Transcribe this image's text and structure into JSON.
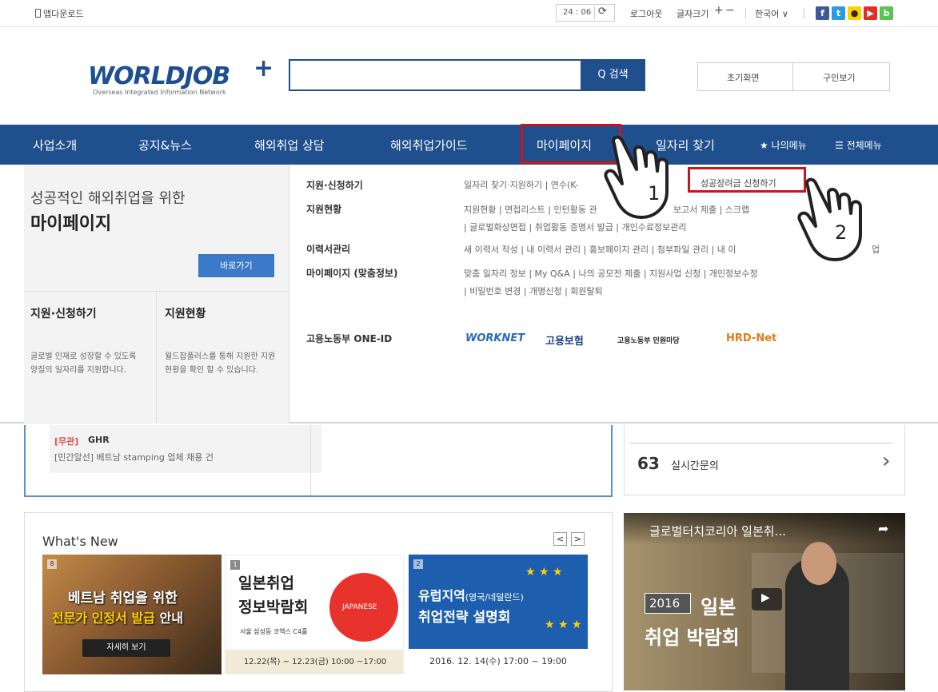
{
  "topbar": {
    "app_download": "앱다운로드",
    "timer": "24 : 06",
    "logout": "로그아웃",
    "font_size": "글자크기",
    "plus": "+",
    "minus": "−",
    "language": "한국어 ∨"
  },
  "header": {
    "logo_text": "WORLDJOB",
    "logo_plus": "+",
    "logo_sub": "Overseas Integrated Information Network",
    "search_placeholder": "",
    "search_label": "Q 검색",
    "home_label": "초기화면",
    "recruit_label": "구인보기"
  },
  "nav": {
    "items": [
      "사업소개",
      "공지&뉴스",
      "해외취업 상담",
      "해외취업가이드",
      "마이페이지",
      "일자리 찾기"
    ],
    "my_menu": "★ 나의메뉴",
    "all_menu": "☰ 전체메뉴"
  },
  "dropdown": {
    "tagline": "성공적인 해외취업을 위한",
    "title": "마이페이지",
    "go_button": "바로가기",
    "col1_title": "지원·신청하기",
    "col1_desc": "글로벌 인재로 성장할 수 있도록 양질의 일자리를 지원합니다.",
    "col2_title": "지원현황",
    "col2_desc": "월드잡플러스를 통해 지원한 지원현황을 확인 할 수 있습니다.",
    "sections": [
      {
        "title": "지원·신청하기",
        "lines": [
          "일자리 찾기·지원하기  |  연수(K-"
        ]
      },
      {
        "title": "지원현황",
        "lines": [
          "지원현황  |  면접리스트  |  인턴활동 관",
          "  |  글로벌화상면접  |  취업활동 증명서 발급  |  개인수료정보관리"
        ]
      },
      {
        "title": "이력서관리",
        "lines": [
          "새 이력서 작성  |  내 이력서 관리  |  홍보페이지 관리  |  첨부파일 관리  |  내 이"
        ]
      },
      {
        "title": "마이페이지 (맞춤정보)",
        "lines": [
          "맞춤 일자리 정보  |  My Q&A  |  나의 공모전 제출  |  지원사업 신청  |  개인정보수정",
          "  |  비밀번호 변경  |  개명신청  |  회원탈퇴"
        ]
      },
      {
        "title": "고용노동부 ONE-ID",
        "lines": []
      }
    ],
    "extra_fragments": [
      "보고서 제출  |  스크랩",
      "업"
    ],
    "highlight_link": "성공장려금 신청하기",
    "partners": [
      "WORKNET",
      "고용보험",
      "고용노동부 민원마당",
      "HRD-Net"
    ]
  },
  "annotations": {
    "step1": "1",
    "step2": "2"
  },
  "job_item": {
    "category": "[무관]",
    "company": "GHR",
    "description": "[민간알선] 베트남 stamping 업체 채용 건"
  },
  "qna": {
    "icon": "63",
    "label": "실시간문의",
    "chevron": "›"
  },
  "whats_new": {
    "title": "What's New",
    "prev": "<",
    "next": ">",
    "cards": [
      {
        "badge": "8",
        "line1": "베트남 취업을 위한",
        "line2a": "전문가 인정서 발급",
        "line2b": " 안내",
        "button": "자세히 보기"
      },
      {
        "badge": "1",
        "line1": "일본취업",
        "line2": "정보박람회",
        "place": "서울 삼성동 코엑스 C4홀",
        "circle": "JAPANESE",
        "date": "12.22(목) ~ 12.23(금) 10:00 ~17:00"
      },
      {
        "badge": "2",
        "line1a": "유럽지역",
        "line1b": "(영국/네덜란드)",
        "line2": "취업전략 설명회",
        "date": "2016. 12. 14(수) 17:00 ~ 19:00"
      }
    ]
  },
  "video": {
    "title": "글로벌터치코리아 일본취...",
    "year": "2016",
    "line1": "일본",
    "line2": "취업 박람회"
  }
}
